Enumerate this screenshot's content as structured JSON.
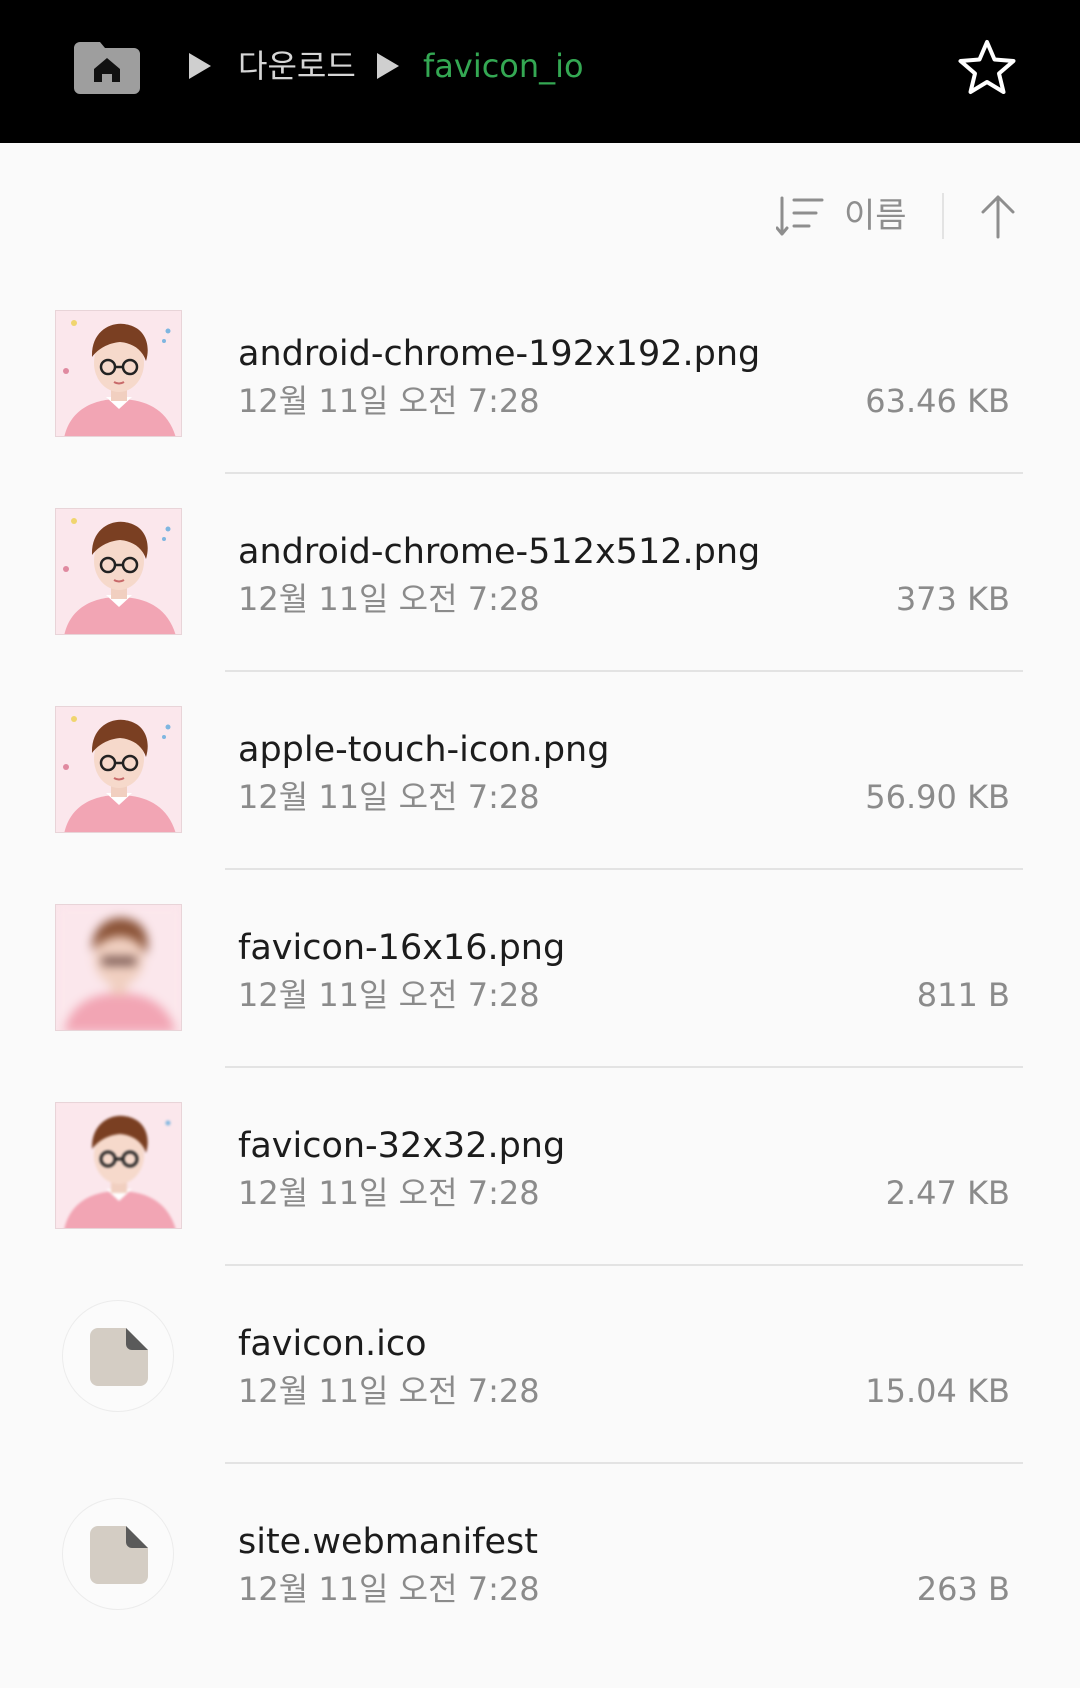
{
  "breadcrumb": {
    "home_icon": "home-folder-icon",
    "separator_icon": "play-arrow-icon",
    "items": [
      "다운로드",
      "favicon_io"
    ],
    "current_color": "#34a853"
  },
  "header": {
    "favorite_icon": "star-outline-icon"
  },
  "sort": {
    "icon": "sort-icon",
    "label": "이름",
    "direction_icon": "arrow-up-icon"
  },
  "files": [
    {
      "name": "android-chrome-192x192.png",
      "date": "12월 11일 오전 7:28",
      "size": "63.46 KB",
      "thumb": "image"
    },
    {
      "name": "android-chrome-512x512.png",
      "date": "12월 11일 오전 7:28",
      "size": "373 KB",
      "thumb": "image"
    },
    {
      "name": "apple-touch-icon.png",
      "date": "12월 11일 오전 7:28",
      "size": "56.90 KB",
      "thumb": "image"
    },
    {
      "name": "favicon-16x16.png",
      "date": "12월 11일 오전 7:28",
      "size": "811 B",
      "thumb": "image-blurred"
    },
    {
      "name": "favicon-32x32.png",
      "date": "12월 11일 오전 7:28",
      "size": "2.47 KB",
      "thumb": "image"
    },
    {
      "name": "favicon.ico",
      "date": "12월 11일 오전 7:28",
      "size": "15.04 KB",
      "thumb": "document-icon"
    },
    {
      "name": "site.webmanifest",
      "date": "12월 11일 오전 7:28",
      "size": "263 B",
      "thumb": "document-icon"
    }
  ]
}
